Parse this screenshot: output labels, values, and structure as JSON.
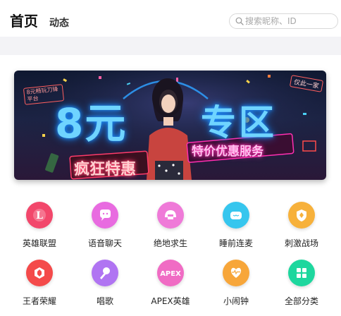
{
  "header": {
    "tab_home": "首页",
    "tab_dynamic": "动态",
    "search_placeholder": "搜索昵称、ID"
  },
  "banner": {
    "headline_left": "8元",
    "headline_right": "专区",
    "slogan_left": "疯狂特惠",
    "slogan_right": "特价优惠服务",
    "corner_sign_left": "8元畅玩刀锋平台",
    "corner_sign_right": "仅此一家"
  },
  "categories": [
    {
      "label": "英雄联盟",
      "icon": "league-of-legends-icon",
      "color": "#f2476b"
    },
    {
      "label": "语音聊天",
      "icon": "chat-bubble-icon",
      "color": "#e86be0"
    },
    {
      "label": "绝地求生",
      "icon": "helmet-icon",
      "color": "#ef7ad8"
    },
    {
      "label": "睡前连麦",
      "icon": "pillow-icon",
      "color": "#36c6ee"
    },
    {
      "label": "刺激战场",
      "icon": "shield-icon",
      "color": "#f7b13b"
    },
    {
      "label": "王者荣耀",
      "icon": "honor-of-kings-icon",
      "color": "#f44a4a"
    },
    {
      "label": "唱歌",
      "icon": "microphone-icon",
      "color": "#b074f2"
    },
    {
      "label": "APEX英雄",
      "icon": "apex-icon",
      "color": "#f06cc4",
      "badge_text": "APEX"
    },
    {
      "label": "小闹钟",
      "icon": "heartbeat-clock-icon",
      "color": "#f7a63a"
    },
    {
      "label": "全部分类",
      "icon": "grid-icon",
      "color": "#1ed79e"
    }
  ]
}
